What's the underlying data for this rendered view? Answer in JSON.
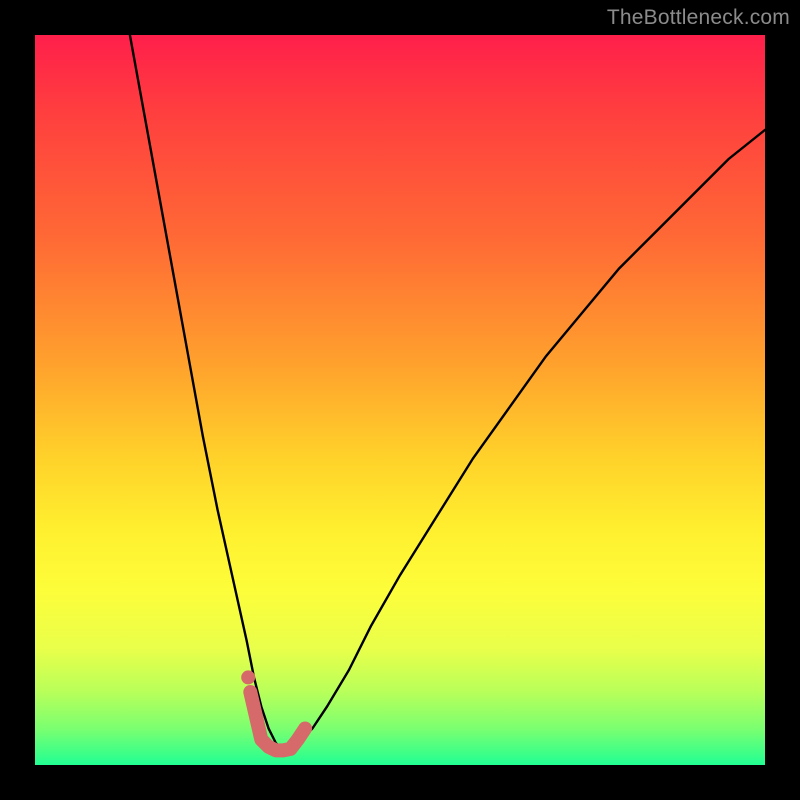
{
  "watermark": "TheBottleneck.com",
  "colors": {
    "frame": "#000000",
    "gradient_top": "#ff1f4b",
    "gradient_bottom": "#21ff93",
    "curve": "#000000",
    "marker": "#d66a6a"
  },
  "chart_data": {
    "type": "line",
    "title": "",
    "xlabel": "",
    "ylabel": "",
    "xlim": [
      0,
      100
    ],
    "ylim": [
      0,
      100
    ],
    "series": [
      {
        "name": "bottleneck-curve",
        "x": [
          13,
          15,
          17,
          19,
          21,
          23,
          25,
          27,
          29,
          30,
          31,
          32,
          33,
          34,
          35,
          36,
          38,
          40,
          43,
          46,
          50,
          55,
          60,
          65,
          70,
          75,
          80,
          85,
          90,
          95,
          100
        ],
        "y": [
          100,
          89,
          78,
          67,
          56,
          45,
          35,
          26,
          17,
          12,
          8,
          5,
          3,
          2,
          2,
          3,
          5,
          8,
          13,
          19,
          26,
          34,
          42,
          49,
          56,
          62,
          68,
          73,
          78,
          83,
          87
        ]
      }
    ],
    "markers": {
      "name": "highlight-dots",
      "x": [
        29.5,
        31,
        32,
        33,
        34,
        35,
        36,
        37
      ],
      "y": [
        10,
        3.5,
        2.5,
        2,
        2,
        2.2,
        3.5,
        5
      ]
    }
  }
}
